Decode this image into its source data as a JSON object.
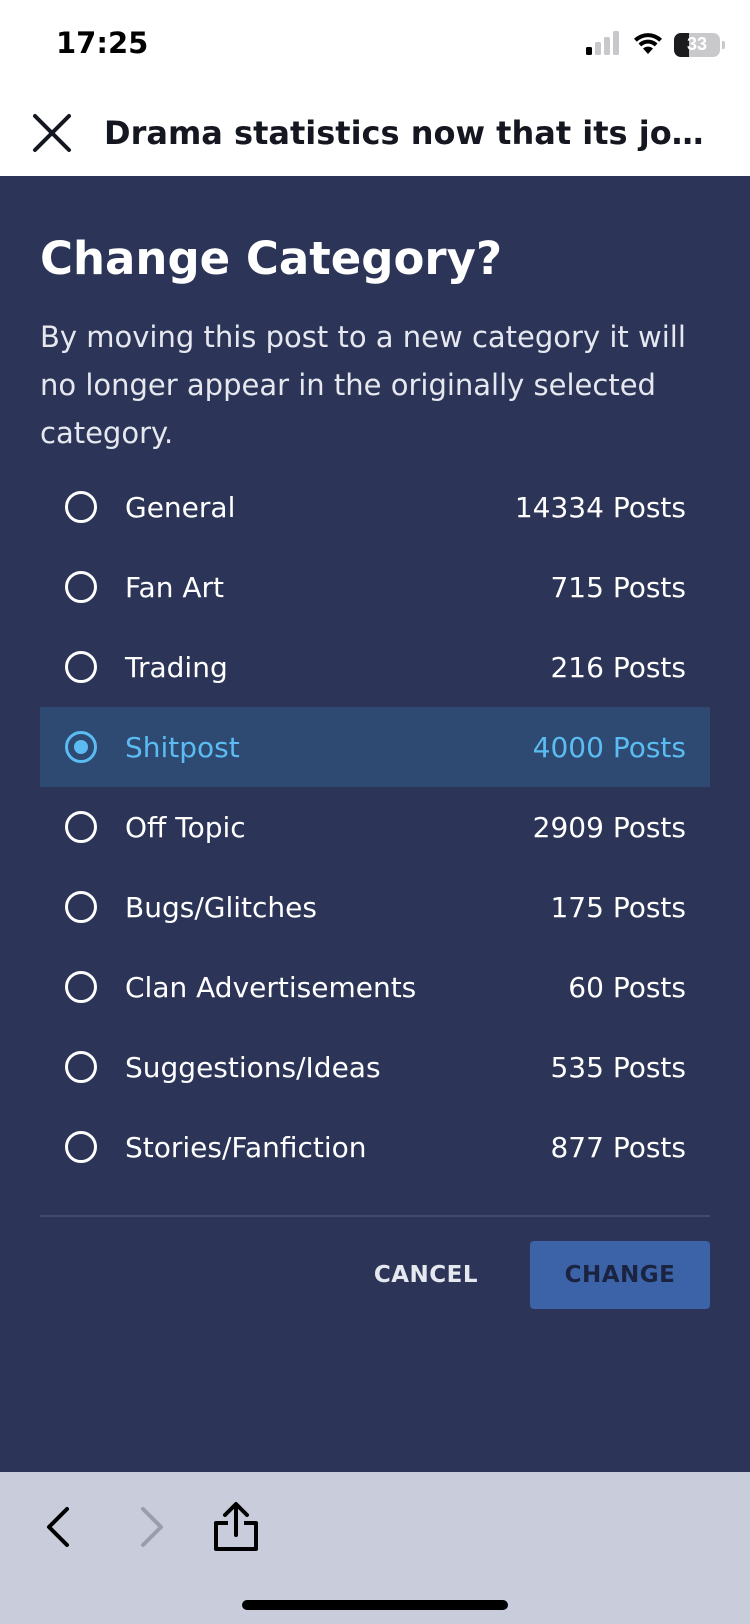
{
  "status_bar": {
    "time": "17:25",
    "battery_level": "33",
    "battery_fraction": 0.33,
    "icons": [
      "cellular-signal-icon",
      "wifi-icon",
      "battery-icon"
    ]
  },
  "header": {
    "title": "Drama statistics now that its joever...",
    "close_icon": "close-icon"
  },
  "dialog": {
    "title": "Change Category?",
    "description": "By moving this post to a new category it will no longer appear in the originally selected category.",
    "options": [
      {
        "label": "General",
        "count": "14334 Posts",
        "selected": false
      },
      {
        "label": "Fan Art",
        "count": "715 Posts",
        "selected": false
      },
      {
        "label": "Trading",
        "count": "216 Posts",
        "selected": false
      },
      {
        "label": "Shitpost",
        "count": "4000 Posts",
        "selected": true
      },
      {
        "label": "Off Topic",
        "count": "2909 Posts",
        "selected": false
      },
      {
        "label": "Bugs/Glitches",
        "count": "175 Posts",
        "selected": false
      },
      {
        "label": "Clan Advertisements",
        "count": "60 Posts",
        "selected": false
      },
      {
        "label": "Suggestions/Ideas",
        "count": "535 Posts",
        "selected": false
      },
      {
        "label": "Stories/Fanfiction",
        "count": "877 Posts",
        "selected": false
      }
    ],
    "cancel_label": "CANCEL",
    "change_label": "CHANGE"
  },
  "browser_bar": {
    "icons": [
      "back-chevron-icon",
      "forward-chevron-icon",
      "share-icon"
    ]
  },
  "colors": {
    "background": "#2c3557",
    "selected_row": "#2e4a73",
    "accent": "#5bbcf2",
    "change_button": "#3c62a8",
    "browser_bar": "#c8ccdb"
  }
}
